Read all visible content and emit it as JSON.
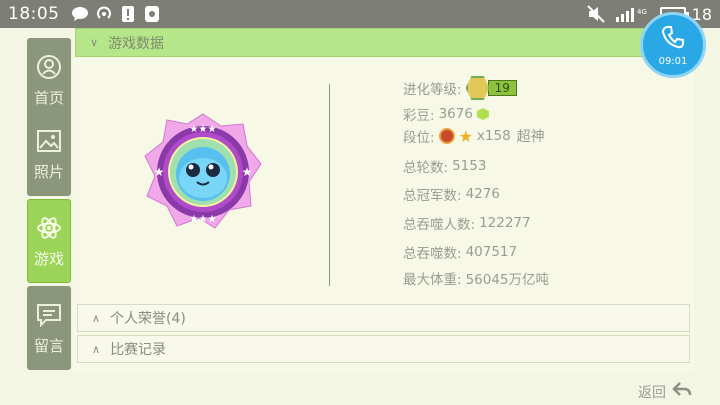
{
  "status_bar": {
    "time": "18:05",
    "battery": "18",
    "network_label": "4G",
    "icons": [
      "chat-icon",
      "hotspot-icon",
      "alert-icon",
      "sim-icon",
      "mute-icon",
      "signal-icon",
      "battery-icon"
    ]
  },
  "nav": {
    "items": [
      {
        "label": "首页",
        "icon": "home-icon"
      },
      {
        "label": "照片",
        "icon": "photo-icon"
      },
      {
        "label": "游戏",
        "icon": "atom-icon"
      },
      {
        "label": "留言",
        "icon": "message-icon"
      }
    ]
  },
  "sections": {
    "game_data": "游戏数据",
    "honors": "个人荣誉(4)",
    "match_records": "比赛记录"
  },
  "stats": {
    "evolution_label": "进化等级:",
    "evolution_level": "19",
    "beans_label": "彩豆:",
    "beans_value": "3676",
    "rank_label": "段位:",
    "rank_stars": "x158",
    "rank_title": "超神",
    "total_rounds_label": "总轮数:",
    "total_rounds": "5153",
    "total_wins_label": "总冠军数:",
    "total_wins": "4276",
    "total_swallow_people_label": "总吞噬人数:",
    "total_swallow_people": "122277",
    "total_swallow_label": "总吞噬数:",
    "total_swallow": "407517",
    "max_weight_label": "最大体重:",
    "max_weight": "56045万亿吨"
  },
  "call": {
    "timer": "09:01"
  },
  "back_label": "返回"
}
